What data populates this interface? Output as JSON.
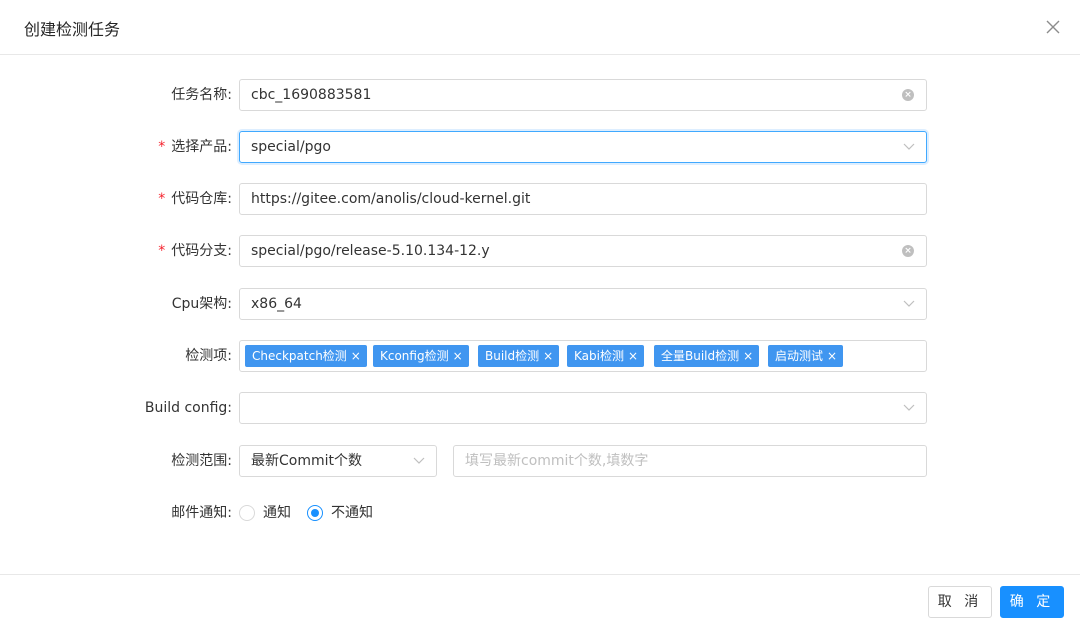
{
  "dialog": {
    "title": "创建检测任务"
  },
  "form": {
    "task_name": {
      "label": "任务名称:",
      "value": "cbc_1690883581"
    },
    "product": {
      "label": "选择产品:",
      "required": "*",
      "value": "special/pgo"
    },
    "repo": {
      "label": "代码仓库:",
      "required": "*",
      "value": "https://gitee.com/anolis/cloud-kernel.git"
    },
    "branch": {
      "label": "代码分支:",
      "required": "*",
      "value": "special/pgo/release-5.10.134-12.y"
    },
    "cpu_arch": {
      "label": "Cpu架构:",
      "value": "x86_64"
    },
    "check_items": {
      "label": "检测项:",
      "tags": [
        "Checkpatch检测",
        "Kconfig检测",
        "Build检测",
        "Kabi检测",
        "全量Build检测",
        "启动测试"
      ]
    },
    "build_config": {
      "label": "Build config:",
      "value": ""
    },
    "scope": {
      "label": "检测范围:",
      "select_value": "最新Commit个数",
      "input_placeholder": "填写最新commit个数,填数字"
    },
    "email": {
      "label": "邮件通知:",
      "options": [
        "通知",
        "不通知"
      ],
      "selected": "不通知"
    }
  },
  "footer": {
    "cancel_label": "取 消",
    "ok_label": "确 定"
  },
  "colors": {
    "primary": "#1890ff",
    "tag": "#4096f0",
    "required": "#f5222d"
  },
  "tag_close_glyph": "×"
}
